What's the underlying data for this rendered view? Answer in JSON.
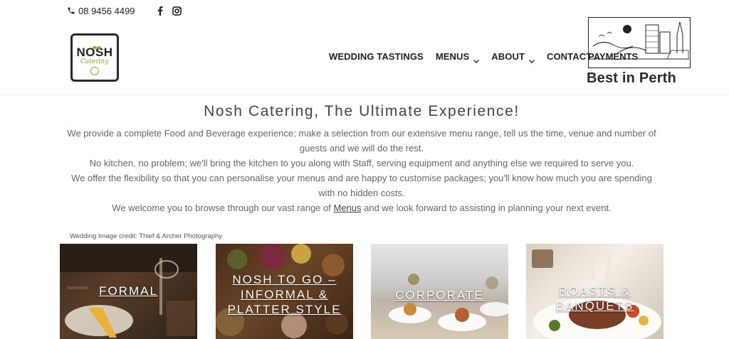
{
  "topbar": {
    "phone": "08 9456 4499",
    "icons": [
      "phone-icon",
      "facebook-icon",
      "instagram-icon"
    ]
  },
  "logo": {
    "name": "NOSH",
    "sub": "Catering"
  },
  "nav": {
    "items": [
      {
        "label": "WEDDING TASTINGS",
        "dropdown": false
      },
      {
        "label": "MENUS",
        "dropdown": true
      },
      {
        "label": "ABOUT",
        "dropdown": true
      },
      {
        "label": "CONTACT",
        "dropdown": false
      },
      {
        "label": "PAYMENTS",
        "dropdown": false
      }
    ]
  },
  "badge": {
    "text": "Best in Perth"
  },
  "intro": {
    "title": "Nosh Catering, The Ultimate Experience!",
    "p1": "We provide a complete Food and Beverage experience; make a selection from our extensive menu range, tell us the time, venue and number of guests and we will do the rest.",
    "p2": "No kitchen, no problem; we'll bring the kitchen to you along with Staff, serving equipment and anything else we required to serve you.",
    "p3": "We offer the flexibility so that you can personalise your menus and are happy to customise packages; you'll know how much you are spending with no hidden costs.",
    "p4_before": "We welcome you to browse through our vast range of ",
    "p4_link": "Menus",
    "p4_after": " and we look forward to assisting in planning your next event."
  },
  "credit": "Wedding Image credit: Thief & Archer Photography",
  "tiles": [
    {
      "label": "FORMAL"
    },
    {
      "label": "NOSH TO GO – INFORMAL & PLATTER STYLE"
    },
    {
      "label": "CORPORATE"
    },
    {
      "label": "ROASTS & BANQUETS"
    }
  ],
  "colors": {
    "nav_text": "#222222",
    "body_text": "#666666",
    "logo_green": "#7bb03a",
    "background": "#ffffff"
  }
}
